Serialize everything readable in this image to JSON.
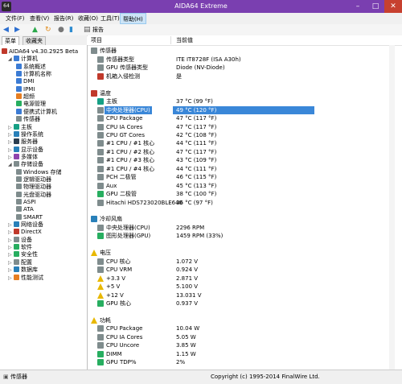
{
  "window": {
    "title": "AIDA64 Extreme",
    "icon_label": "64",
    "min": "–",
    "max": "□",
    "close": "✕"
  },
  "menu": [
    "文件(F)",
    "查看(V)",
    "报告(R)",
    "收藏(O)",
    "工具(T)",
    "帮助(H)"
  ],
  "toolbar": {
    "report_label": "报告"
  },
  "tabs": [
    "菜单",
    "收藏夹"
  ],
  "tree": [
    {
      "label": "AIDA64 v4.30.2925 Beta",
      "x": 2,
      "icon": "#c0392b"
    },
    {
      "label": "计算机",
      "x": 10,
      "icon": "#3b7bd4",
      "toggle": "◢"
    },
    {
      "label": "系统概述",
      "x": 20,
      "icon": "#3b7bd4"
    },
    {
      "label": "计算机名称",
      "x": 20,
      "icon": "#3b7bd4"
    },
    {
      "label": "DMI",
      "x": 20,
      "icon": "#3b7bd4"
    },
    {
      "label": "IPMI",
      "x": 20,
      "icon": "#3b7bd4"
    },
    {
      "label": "超频",
      "x": 20,
      "icon": "#e67e22"
    },
    {
      "label": "电源管理",
      "x": 20,
      "icon": "#27ae60"
    },
    {
      "label": "便携式计算机",
      "x": 20,
      "icon": "#3b7bd4"
    },
    {
      "label": "传感器",
      "x": 20,
      "icon": "#7f8c8d"
    },
    {
      "label": "主板",
      "x": 10,
      "icon": "#16a085",
      "toggle": "▷"
    },
    {
      "label": "操作系统",
      "x": 10,
      "icon": "#2980b9",
      "toggle": "▷"
    },
    {
      "label": "服务器",
      "x": 10,
      "icon": "#2c3e50",
      "toggle": "▷"
    },
    {
      "label": "显示设备",
      "x": 10,
      "icon": "#2980b9",
      "toggle": "▷"
    },
    {
      "label": "多媒体",
      "x": 10,
      "icon": "#8e44ad",
      "toggle": "▷"
    },
    {
      "label": "存储设备",
      "x": 10,
      "icon": "#7f8c8d",
      "toggle": "◢"
    },
    {
      "label": "Windows 存储",
      "x": 20,
      "icon": "#7f8c8d"
    },
    {
      "label": "逻辑驱动器",
      "x": 20,
      "icon": "#7f8c8d"
    },
    {
      "label": "物理驱动器",
      "x": 20,
      "icon": "#7f8c8d"
    },
    {
      "label": "光盘驱动器",
      "x": 20,
      "icon": "#7f8c8d"
    },
    {
      "label": "ASPI",
      "x": 20,
      "icon": "#7f8c8d"
    },
    {
      "label": "ATA",
      "x": 20,
      "icon": "#7f8c8d"
    },
    {
      "label": "SMART",
      "x": 20,
      "icon": "#7f8c8d"
    },
    {
      "label": "网络设备",
      "x": 10,
      "icon": "#2980b9",
      "toggle": "▷"
    },
    {
      "label": "DirectX",
      "x": 10,
      "icon": "#c0392b",
      "toggle": "▷"
    },
    {
      "label": "设备",
      "x": 10,
      "icon": "#7f8c8d",
      "toggle": "▷"
    },
    {
      "label": "软件",
      "x": 10,
      "icon": "#27ae60",
      "toggle": "▷"
    },
    {
      "label": "安全性",
      "x": 10,
      "icon": "#27ae60",
      "toggle": "▷"
    },
    {
      "label": "配置",
      "x": 10,
      "icon": "#7f8c8d",
      "toggle": "▷"
    },
    {
      "label": "数据库",
      "x": 10,
      "icon": "#2980b9",
      "toggle": "▷"
    },
    {
      "label": "性能测试",
      "x": 10,
      "icon": "#e67e22",
      "toggle": "▷"
    }
  ],
  "columns": {
    "field": "项目",
    "value": "当前值"
  },
  "sections": [
    {
      "type": "header",
      "label": "传感器",
      "y": 1,
      "icon": "#7f8c8d"
    },
    {
      "type": "row",
      "field": "传感器类型",
      "value": "ITE IT8728F  (ISA A30h)",
      "y": 2,
      "icon": "#7f8c8d"
    },
    {
      "type": "row",
      "field": "GPU 传感器类型",
      "value": "Diode  (NV-Diode)",
      "y": 3,
      "icon": "#7f8c8d"
    },
    {
      "type": "row",
      "field": "机箱入侵检测",
      "value": "是",
      "y": 4,
      "icon": "#c0392b"
    },
    {
      "type": "header",
      "label": "温度",
      "y": 6,
      "icon": "#c0392b"
    },
    {
      "type": "row",
      "field": "主板",
      "value": "37 °C  (99 °F)",
      "y": 7,
      "icon": "#16a085"
    },
    {
      "type": "row",
      "field": "中央处理器(CPU)",
      "value": "49 °C  (120 °F)",
      "y": 8,
      "icon": "#7f8c8d",
      "selected": true
    },
    {
      "type": "row",
      "field": "CPU Package",
      "value": "47 °C  (117 °F)",
      "y": 9,
      "icon": "#7f8c8d"
    },
    {
      "type": "row",
      "field": "CPU IA Cores",
      "value": "47 °C  (117 °F)",
      "y": 10,
      "icon": "#7f8c8d"
    },
    {
      "type": "row",
      "field": "CPU GT Cores",
      "value": "42 °C  (108 °F)",
      "y": 11,
      "icon": "#7f8c8d"
    },
    {
      "type": "row",
      "field": "#1 CPU / #1 核心",
      "value": "44 °C  (111 °F)",
      "y": 12,
      "icon": "#7f8c8d"
    },
    {
      "type": "row",
      "field": "#1 CPU / #2 核心",
      "value": "47 °C  (117 °F)",
      "y": 13,
      "icon": "#7f8c8d"
    },
    {
      "type": "row",
      "field": "#1 CPU / #3 核心",
      "value": "43 °C  (109 °F)",
      "y": 14,
      "icon": "#7f8c8d"
    },
    {
      "type": "row",
      "field": "#1 CPU / #4 核心",
      "value": "44 °C  (111 °F)",
      "y": 15,
      "icon": "#7f8c8d"
    },
    {
      "type": "row",
      "field": "PCH 二极管",
      "value": "46 °C  (115 °F)",
      "y": 16,
      "icon": "#7f8c8d"
    },
    {
      "type": "row",
      "field": "Aux",
      "value": "45 °C  (113 °F)",
      "y": 17,
      "icon": "#7f8c8d"
    },
    {
      "type": "row",
      "field": "GPU 二极管",
      "value": "38 °C  (100 °F)",
      "y": 18,
      "icon": "#27ae60"
    },
    {
      "type": "row",
      "field": "Hitachi HDS723020BLE640",
      "value": "36 °C  (97 °F)",
      "y": 19,
      "icon": "#7f8c8d"
    },
    {
      "type": "header",
      "label": "冷却风扇",
      "y": 21,
      "icon": "#2980b9"
    },
    {
      "type": "row",
      "field": "中央处理器(CPU)",
      "value": "2296 RPM",
      "y": 22,
      "icon": "#7f8c8d"
    },
    {
      "type": "row",
      "field": "图形处理器(GPU)",
      "value": "1459 RPM  (33%)",
      "y": 23,
      "icon": "#27ae60"
    },
    {
      "type": "header",
      "label": "电压",
      "y": 25,
      "icon": "warn"
    },
    {
      "type": "row",
      "field": "CPU 核心",
      "value": "1.072 V",
      "y": 26,
      "icon": "#7f8c8d"
    },
    {
      "type": "row",
      "field": "CPU VRM",
      "value": "0.924 V",
      "y": 27,
      "icon": "#7f8c8d"
    },
    {
      "type": "row",
      "field": "+3.3 V",
      "value": "2.871 V",
      "y": 28,
      "icon": "warn"
    },
    {
      "type": "row",
      "field": "+5 V",
      "value": "5.100 V",
      "y": 29,
      "icon": "warn"
    },
    {
      "type": "row",
      "field": "+12 V",
      "value": "13.031 V",
      "y": 30,
      "icon": "warn"
    },
    {
      "type": "row",
      "field": "GPU 核心",
      "value": "0.937 V",
      "y": 31,
      "icon": "#27ae60"
    },
    {
      "type": "header",
      "label": "功耗",
      "y": 33,
      "icon": "warn"
    },
    {
      "type": "row",
      "field": "CPU Package",
      "value": "10.04 W",
      "y": 34,
      "icon": "#7f8c8d"
    },
    {
      "type": "row",
      "field": "CPU IA Cores",
      "value": "5.05 W",
      "y": 35,
      "icon": "#7f8c8d"
    },
    {
      "type": "row",
      "field": "CPU Uncore",
      "value": "3.85 W",
      "y": 36,
      "icon": "#7f8c8d"
    },
    {
      "type": "row",
      "field": "DIMM",
      "value": "1.15 W",
      "y": 37,
      "icon": "#27ae60"
    },
    {
      "type": "row",
      "field": "GPU TDP%",
      "value": "2%",
      "y": 38,
      "icon": "#27ae60"
    }
  ],
  "status": {
    "left": "传感器",
    "right": "Copyright (c) 1995-2014 FinalWire Ltd."
  }
}
